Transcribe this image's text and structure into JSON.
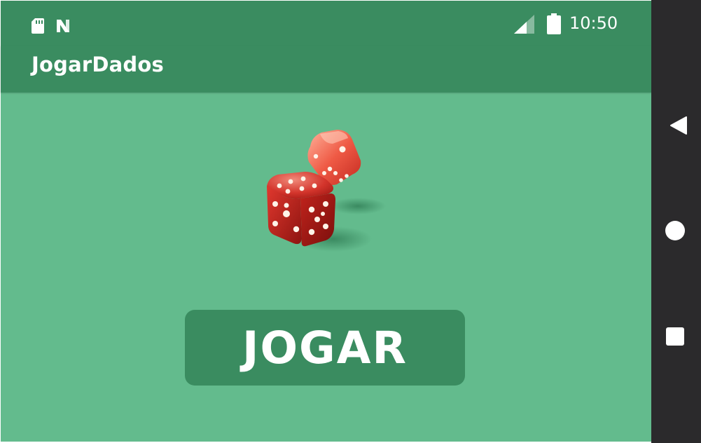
{
  "status_bar": {
    "time": "10:50",
    "icons": [
      "sd-card-icon",
      "notification-n-icon",
      "signal-icon",
      "battery-icon"
    ]
  },
  "app_bar": {
    "title": "JogarDados"
  },
  "main": {
    "image": "dice-icon",
    "play_button_label": "JOGAR"
  },
  "nav_bar": {
    "buttons": [
      "back-icon",
      "home-icon",
      "recents-icon"
    ]
  },
  "colors": {
    "primary_dark": "#3a8c60",
    "background": "#63bb8d",
    "nav_bar": "#2b2a2c",
    "text": "#ffffff"
  }
}
